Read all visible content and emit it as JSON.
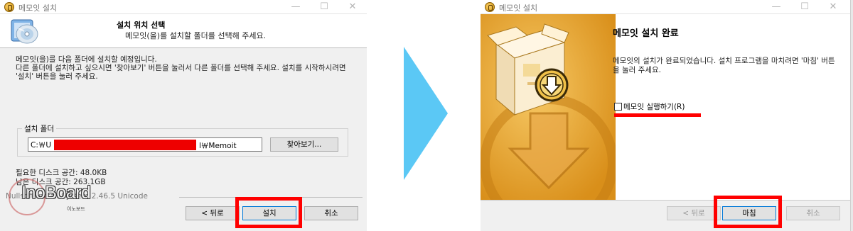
{
  "left_window": {
    "title": "메모잇 설치",
    "controls": {
      "minimize": "—",
      "maximize": "☐",
      "close": "✕"
    },
    "header_title": "설치 위치 선택",
    "header_subtitle": "메모잇(을)를 설치할 폴더를 선택해 주세요.",
    "description": "메모잇(을)를 다음 폴더에 설치할 예정입니다.\n다른 폴더에 설치하고 싶으시면 '찾아보기' 버튼을 눌러서 다른 폴더를 선택해 주세요. 설치를 시작하시려면 '설치' 버튼을 눌러 주세요.",
    "group_label": "설치 폴더",
    "path_prefix": "C:￦U",
    "path_suffix": "l￦Memoit",
    "browse_button": "찾아보기...",
    "required_space": "필요한 디스크 공간: 48.0KB",
    "available_space": "남은 디스크 공간: 263.1GB",
    "nsis_text": "Nullsoft Install System 2.46.5 Unicode",
    "back_button": "< 뒤로",
    "install_button": "설치",
    "cancel_button": "취소"
  },
  "watermark": {
    "brand": "InoBoard",
    "sub": "이노보드"
  },
  "right_window": {
    "title": "메모잇 설치",
    "controls": {
      "minimize": "—",
      "maximize": "☐",
      "close": "✕"
    },
    "heading": "메모잇 설치 완료",
    "description": "메모잇의 설치가 완료되었습니다. 설치 프로그램을 마치려면 '마침' 버튼을 눌러 주세요.",
    "run_checkbox": "메모잇 실행하기(R)",
    "run_checked": false,
    "back_button": "< 뒤로",
    "finish_button": "마침",
    "cancel_button": "취소"
  },
  "colors": {
    "highlight": "#ff0000",
    "arrow": "#5bc8f5",
    "art": "#e7a62a"
  }
}
